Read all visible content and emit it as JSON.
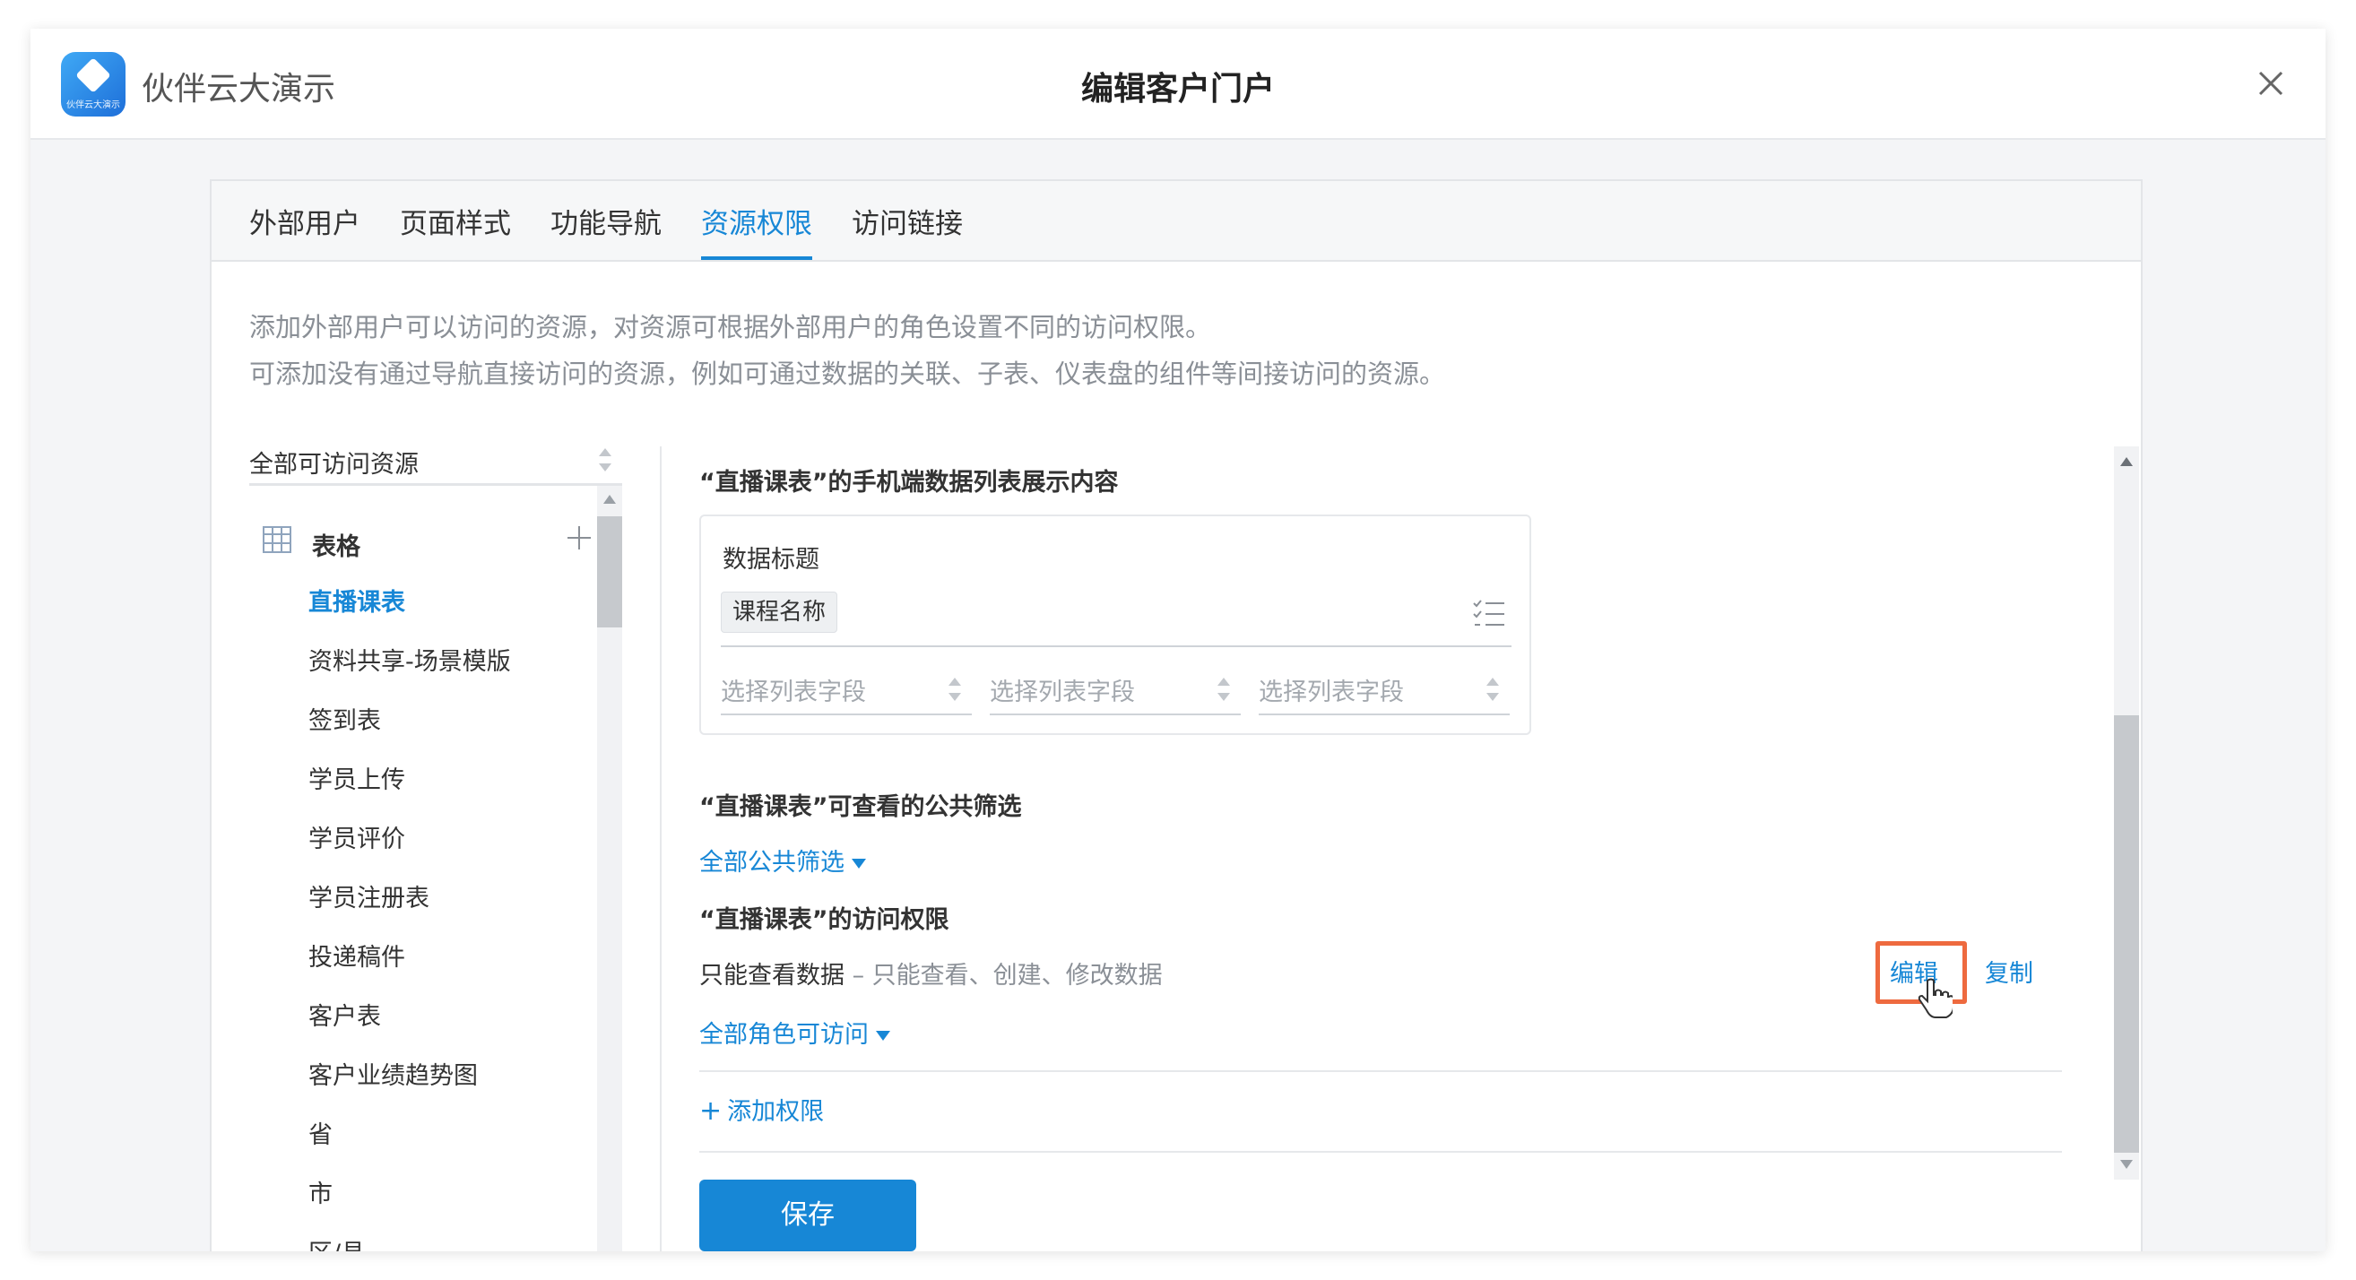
{
  "app": {
    "name": "伙伴云大演示",
    "logo_text": "伙伴云大演示"
  },
  "modal": {
    "title": "编辑客户门户",
    "close_icon": "close-icon"
  },
  "tabs": [
    {
      "label": "外部用户",
      "active": false
    },
    {
      "label": "页面样式",
      "active": false
    },
    {
      "label": "功能导航",
      "active": false
    },
    {
      "label": "资源权限",
      "active": true
    },
    {
      "label": "访问链接",
      "active": false
    }
  ],
  "description": {
    "line1": "添加外部用户可以访问的资源，对资源可根据外部用户的角色设置不同的访问权限。",
    "line2": "可添加没有通过导航直接访问的资源，例如可通过数据的关联、子表、仪表盘的组件等间接访问的资源。"
  },
  "resources": {
    "filter_value": "全部可访问资源",
    "group_label": "表格",
    "items": [
      {
        "label": "直播课表",
        "active": true
      },
      {
        "label": "资料共享-场景模版",
        "active": false
      },
      {
        "label": "签到表",
        "active": false
      },
      {
        "label": "学员上传",
        "active": false
      },
      {
        "label": "学员评价",
        "active": false
      },
      {
        "label": "学员注册表",
        "active": false
      },
      {
        "label": "投递稿件",
        "active": false
      },
      {
        "label": "客户表",
        "active": false
      },
      {
        "label": "客户业绩趋势图",
        "active": false
      },
      {
        "label": "省",
        "active": false
      },
      {
        "label": "市",
        "active": false
      },
      {
        "label": "区/县",
        "active": false
      }
    ]
  },
  "detail": {
    "mobile_section_title": "“直播课表”的手机端数据列表展示内容",
    "data_title_label": "数据标题",
    "data_title_chip": "课程名称",
    "column_selects": [
      "选择列表字段",
      "选择列表字段",
      "选择列表字段"
    ],
    "filter_section_title": "“直播课表”可查看的公共筛选",
    "filter_link": "全部公共筛选",
    "access_section_title": "“直播课表”的访问权限",
    "permission": {
      "name": "只能查看数据",
      "separator": " – ",
      "description": "只能查看、创建、修改数据",
      "edit_label": "编辑",
      "copy_label": "复制",
      "roles_link": "全部角色可访问"
    },
    "add_permission_label": "添加权限",
    "save_label": "保存"
  },
  "colors": {
    "accent": "#1787d6",
    "highlight": "#ee6a3f"
  }
}
